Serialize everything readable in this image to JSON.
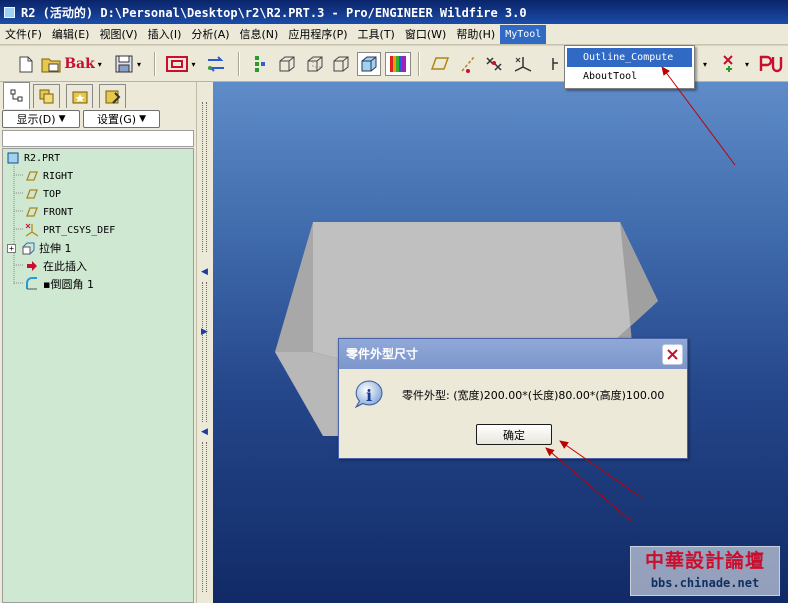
{
  "window": {
    "title": "R2 (活动的) D:\\Personal\\Desktop\\r2\\R2.PRT.3 - Pro/ENGINEER Wildfire 3.0"
  },
  "menubar": {
    "items": [
      {
        "id": "file",
        "label": "文件(F)"
      },
      {
        "id": "edit",
        "label": "编辑(E)"
      },
      {
        "id": "view",
        "label": "视图(V)"
      },
      {
        "id": "insert",
        "label": "插入(I)"
      },
      {
        "id": "analysis",
        "label": "分析(A)"
      },
      {
        "id": "info",
        "label": "信息(N)"
      },
      {
        "id": "apps",
        "label": "应用程序(P)"
      },
      {
        "id": "tools",
        "label": "工具(T)"
      },
      {
        "id": "window",
        "label": "窗口(W)"
      },
      {
        "id": "help",
        "label": "帮助(H)"
      },
      {
        "id": "mytool",
        "label": "MyTool"
      }
    ]
  },
  "dropdown": {
    "items": [
      {
        "label": "Outline_Compute",
        "highlighted": true
      },
      {
        "label": "AboutTool",
        "highlighted": false
      }
    ]
  },
  "toolbar": {
    "backup_label": "Bak",
    "icons": [
      "new-file",
      "open-file",
      "backup",
      "save",
      "csys",
      "regen",
      "datum-display",
      "box-wire",
      "box-hidden",
      "box-nohidden",
      "shaded",
      "color-appearance",
      "plane-display",
      "axis-display",
      "point-display",
      "csys-display",
      "spin-center",
      "pu"
    ]
  },
  "left_panel": {
    "tabs": [
      "model-tree",
      "layers",
      "favorites",
      "tools"
    ],
    "show_button": "显示(D)",
    "settings_button": "设置(G)",
    "tree": [
      {
        "label": "R2.PRT",
        "icon": "part-icon",
        "level": 0
      },
      {
        "label": "RIGHT",
        "icon": "datum-plane-icon",
        "level": 1
      },
      {
        "label": "TOP",
        "icon": "datum-plane-icon",
        "level": 1
      },
      {
        "label": "FRONT",
        "icon": "datum-plane-icon",
        "level": 1
      },
      {
        "label": "PRT_CSYS_DEF",
        "icon": "csys-icon",
        "level": 1
      },
      {
        "label": "拉伸 1",
        "icon": "extrude-icon",
        "level": 1,
        "expandable": true
      },
      {
        "label": "在此插入",
        "icon": "insert-here-icon",
        "level": 1
      },
      {
        "label": "▪倒圆角 1",
        "icon": "round-icon",
        "level": 1
      }
    ]
  },
  "dialog": {
    "title": "零件外型尺寸",
    "message": "零件外型: (宽度)200.00*(长度)80.00*(高度)100.00",
    "ok_label": "确定"
  },
  "watermark": {
    "line1": "中華設計論壇",
    "line2": "bbs.chinade.net"
  },
  "colors": {
    "title_bar": "#0a246a",
    "menu_highlight": "#316ac5",
    "tree_bg": "#cfe8d2",
    "viewport_top": "#5f8cc9",
    "viewport_bottom": "#112a66",
    "annotation_arrow": "#c00000"
  }
}
